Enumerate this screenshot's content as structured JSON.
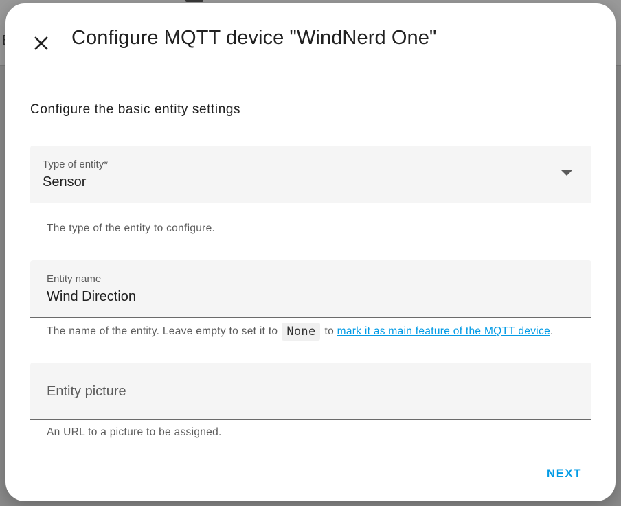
{
  "background": {
    "partial_text": "E"
  },
  "dialog": {
    "title": "Configure MQTT device \"WindNerd One\"",
    "close_icon": "close-icon",
    "section_heading": "Configure the basic entity settings",
    "fields": {
      "type": {
        "label": "Type of entity*",
        "value": "Sensor",
        "helper": "The type of the entity to configure."
      },
      "name": {
        "label": "Entity name",
        "value": "Wind Direction",
        "helper_before": "The name of the entity. Leave empty to set it to",
        "helper_code": "None",
        "helper_mid": "to",
        "helper_link": "mark it as main feature of the MQTT device",
        "helper_after": "."
      },
      "picture": {
        "placeholder": "Entity picture",
        "helper": "An URL to a picture to be assigned."
      }
    },
    "next_label": "NEXT"
  },
  "colors": {
    "accent": "#039be5",
    "field_bg": "#f5f5f5",
    "text_primary": "#212121",
    "text_secondary": "#5c5c5c"
  }
}
